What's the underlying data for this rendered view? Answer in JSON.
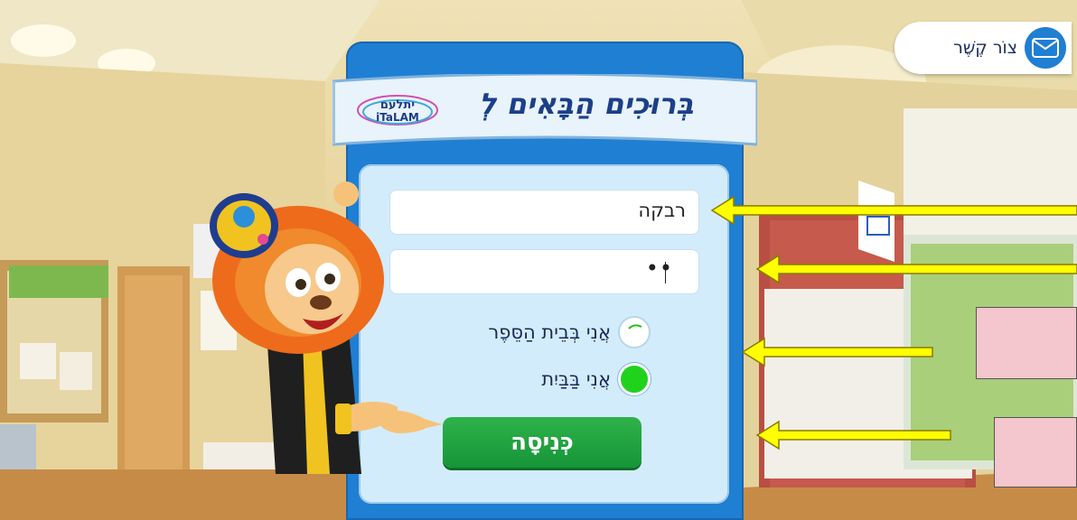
{
  "contact": {
    "label": "צוֹר קֶשֶׁר",
    "icon": "envelope-phone-icon"
  },
  "banner": {
    "title": "בְּרוּכִים הַבָּאִים לְ",
    "logo_text": "יתלעם",
    "logo_sub": "iTaLAM"
  },
  "form": {
    "username_value": "רבקה",
    "password_dots": "••",
    "radio_school": "אֲנִי בְּבֵית הַסֵּפֶר",
    "radio_home": "אֲנִי בַּבַּיִת",
    "selected": "home",
    "enter_label": "כְּנִיסָה"
  },
  "colors": {
    "card": "#1f7fd3",
    "panel": "#d3ecfb",
    "button": "#169538",
    "arrow": "#ffff00",
    "radio_on": "#21d21d"
  },
  "annotations": {
    "arrows": 4,
    "pink_boxes": 2
  }
}
